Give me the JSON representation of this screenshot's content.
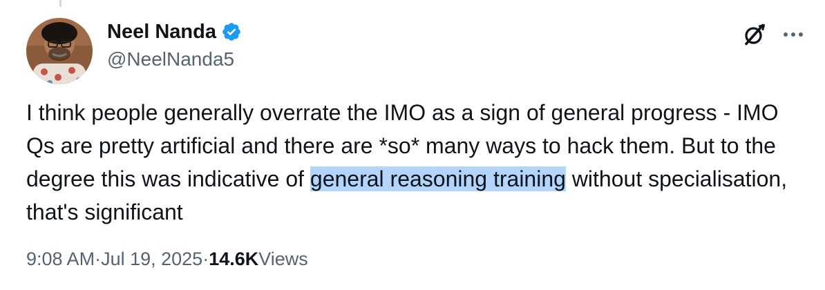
{
  "tweet": {
    "author": {
      "display_name": "Neel Nanda",
      "handle": "@NeelNanda5",
      "verified": true,
      "avatar_icon": "avatar-photo"
    },
    "text": {
      "before_highlight": "I think people generally overrate the IMO as a sign of general progress - IMO Qs are pretty artificial and there are *so* many ways to hack them. But to the degree this was indicative of ",
      "highlight": "general reasoning training",
      "after_highlight": " without specialisation, that's significant"
    },
    "meta": {
      "time": "9:08 AM",
      "separator": "·",
      "date": "Jul 19, 2025",
      "views_count": "14.6K",
      "views_label": "Views"
    },
    "icons": {
      "grok": "grok-icon",
      "more": "more-icon",
      "verified": "verified-badge-icon"
    },
    "colors": {
      "text": "#0f1419",
      "secondary": "#536471",
      "verified_blue": "#1d9bf0",
      "highlight": "#b3d4fc"
    }
  }
}
